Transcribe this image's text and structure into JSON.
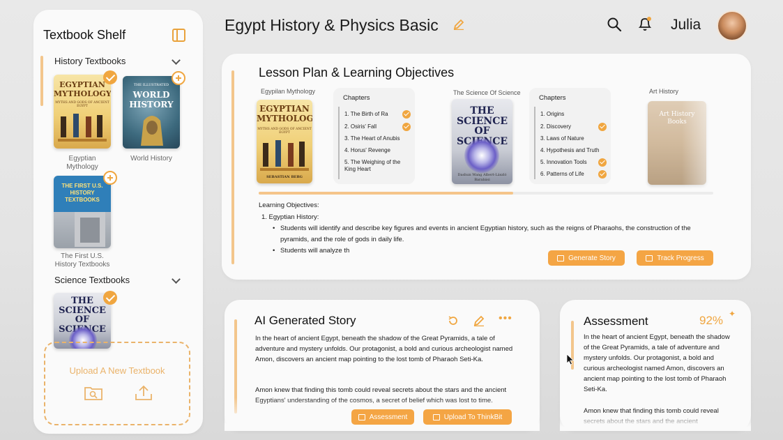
{
  "sidebar": {
    "title": "Textbook Shelf",
    "sections": [
      {
        "label": "History Textbooks"
      },
      {
        "label": "Science Textbooks"
      }
    ],
    "books": {
      "egyptian": {
        "cover_title": "EGYPTIAN MYTHOLOGY",
        "cover_sub": "MYTHS AND GODS OF ANCIENT EGYPT",
        "caption": "Egyptian Mythology"
      },
      "world": {
        "cover_title": "WORLD HISTORY",
        "cover_top": "THE ILLUSTRATED",
        "caption": "World History"
      },
      "us": {
        "cover_title": "THE FIRST U.S. HISTORY TEXTBOOKS",
        "caption": "The First U.S. History Textbooks"
      },
      "science": {
        "cover_title": "THE SCIENCE OF SCIENCE"
      }
    },
    "upload_label": "Upload A New Textbook"
  },
  "header": {
    "title": "Egypt History & Physics Basic",
    "user_name": "Julia"
  },
  "lesson_plan": {
    "title": "Lesson Plan & Learning Objectives",
    "book1": {
      "label": "Egypilan Mythology",
      "cover_title": "EGYPTIAN MYTHOLOGY",
      "cover_sub": "MYTHS AND GODS OF ANCIENT EGYPT",
      "author": "SEBASTIAN BERG"
    },
    "chapters1": {
      "head": "Chapters",
      "items": [
        "1. The Birth of Ra",
        "2. Osiris' Fall",
        "3. The Heart of Anubis",
        "4. Horus' Revenge",
        "5. The Weighing of the King Heart"
      ],
      "done": [
        true,
        true,
        false,
        false,
        false
      ]
    },
    "book2": {
      "label": "The Science Of Science",
      "cover_title": "THE SCIENCE OF SCIENCE",
      "authors": "Dashun Wang  Albert-László Barabási"
    },
    "chapters2": {
      "head": "Chapters",
      "items": [
        "1. Origins",
        "2. Discovery",
        "3. Laws of Nature",
        "4. Hypothesis and Truth",
        "5. Innovation Tools",
        "6. Patterns of Life"
      ],
      "done": [
        false,
        true,
        false,
        false,
        true,
        true
      ]
    },
    "book3": {
      "label": "Art History",
      "cover_title": "Art History Books"
    },
    "progress": 0.56,
    "objectives_heading": "Learning Objectives:",
    "objective_1_title": "1. Egyptian History:",
    "bullet_1": "Students will identify and describe key figures and events in ancient Egyptian history, such as the reigns of Pharaohs, the construction of the pyramids, and the role of gods in daily life.",
    "bullet_2": "Students will analyze th",
    "btn_generate": "Generate Story",
    "btn_track": "Track Progress"
  },
  "story": {
    "title": "AI Generated Story",
    "paragraph_1": "In the heart of ancient Egypt, beneath the shadow of the Great Pyramids, a tale of adventure and mystery unfolds. Our protagonist, a bold and curious archeologist named Amon, discovers an ancient map pointing to the lost tomb of Pharaoh Seti-Ka.",
    "paragraph_2": "Amon knew that finding this tomb could reveal secrets about the stars and the ancient Egyptians' understanding of the cosmos, a secret of belief which was lost to time.",
    "btn_assessment": "Assessment",
    "btn_upload": "Upload To ThinkBit"
  },
  "assessment": {
    "title": "Assessment",
    "score": "92%",
    "paragraph_1": "In the heart of ancient Egypt, beneath the shadow of the Great Pyramids, a tale of adventure and mystery unfolds. Our protagonist, a bold and curious archeologist named Amon, discovers an ancient map pointing to the lost tomb of Pharaoh Seti-Ka.",
    "paragraph_2": "Amon knew that finding this tomb could reveal secrets about the stars and the ancient"
  },
  "colors": {
    "accent": "#f0a640",
    "accent_light": "#f3c68c",
    "card": "#fafafa",
    "background": "#e6e6e6"
  },
  "icons": [
    "sidebar-toggle-icon",
    "chevron-down-icon",
    "check-icon",
    "plus-icon",
    "folder-search-icon",
    "upload-icon",
    "pencil-icon",
    "search-icon",
    "bell-icon",
    "refresh-icon",
    "more-icon",
    "sparkle-icon",
    "cursor-icon"
  ]
}
